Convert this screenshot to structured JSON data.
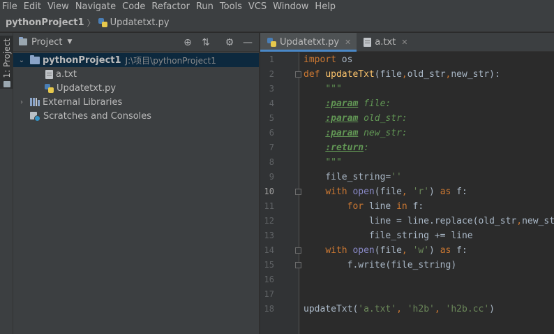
{
  "menu": [
    "File",
    "Edit",
    "View",
    "Navigate",
    "Code",
    "Refactor",
    "Run",
    "Tools",
    "VCS",
    "Window",
    "Help"
  ],
  "breadcrumb": {
    "project": "pythonProject1",
    "file": "Updatetxt.py"
  },
  "stripe": {
    "project_tab": "1: Project"
  },
  "project_panel": {
    "title": "Project",
    "root": {
      "name": "pythonProject1",
      "path": "J:\\项目\\pythonProject1"
    },
    "files": [
      "a.txt",
      "Updatetxt.py"
    ],
    "external_libraries": "External Libraries",
    "scratches": "Scratches and Consoles"
  },
  "editor": {
    "tabs": [
      {
        "label": "Updatetxt.py",
        "active": true
      },
      {
        "label": "a.txt",
        "active": false
      }
    ],
    "current_line": 10,
    "lines": [
      {
        "n": "1",
        "text": "import os"
      },
      {
        "n": "2",
        "text": "def updateTxt(file,old_str,new_str):"
      },
      {
        "n": "3",
        "text": "    \"\"\""
      },
      {
        "n": "4",
        "text": "    :param file:"
      },
      {
        "n": "5",
        "text": "    :param old_str:"
      },
      {
        "n": "6",
        "text": "    :param new_str:"
      },
      {
        "n": "7",
        "text": "    :return:"
      },
      {
        "n": "8",
        "text": "    \"\"\""
      },
      {
        "n": "9",
        "text": "    file_string=''"
      },
      {
        "n": "10",
        "text": "    with open(file, 'r') as f:"
      },
      {
        "n": "11",
        "text": "        for line in f:"
      },
      {
        "n": "12",
        "text": "            line = line.replace(old_str,new_str)"
      },
      {
        "n": "13",
        "text": "            file_string += line"
      },
      {
        "n": "14",
        "text": "    with open(file, 'w') as f:"
      },
      {
        "n": "15",
        "text": "        f.write(file_string)"
      },
      {
        "n": "16",
        "text": ""
      },
      {
        "n": "17",
        "text": ""
      },
      {
        "n": "18",
        "text": "updateTxt('a.txt', 'h2b', 'h2b.cc')"
      }
    ]
  },
  "colors": {
    "keyword": "#cc7832",
    "function": "#ffc66d",
    "string": "#6a8759",
    "docstring": "#629755",
    "builtin": "#8888c6",
    "selection": "#0d293e",
    "active_tab_underline": "#4a88c7"
  }
}
